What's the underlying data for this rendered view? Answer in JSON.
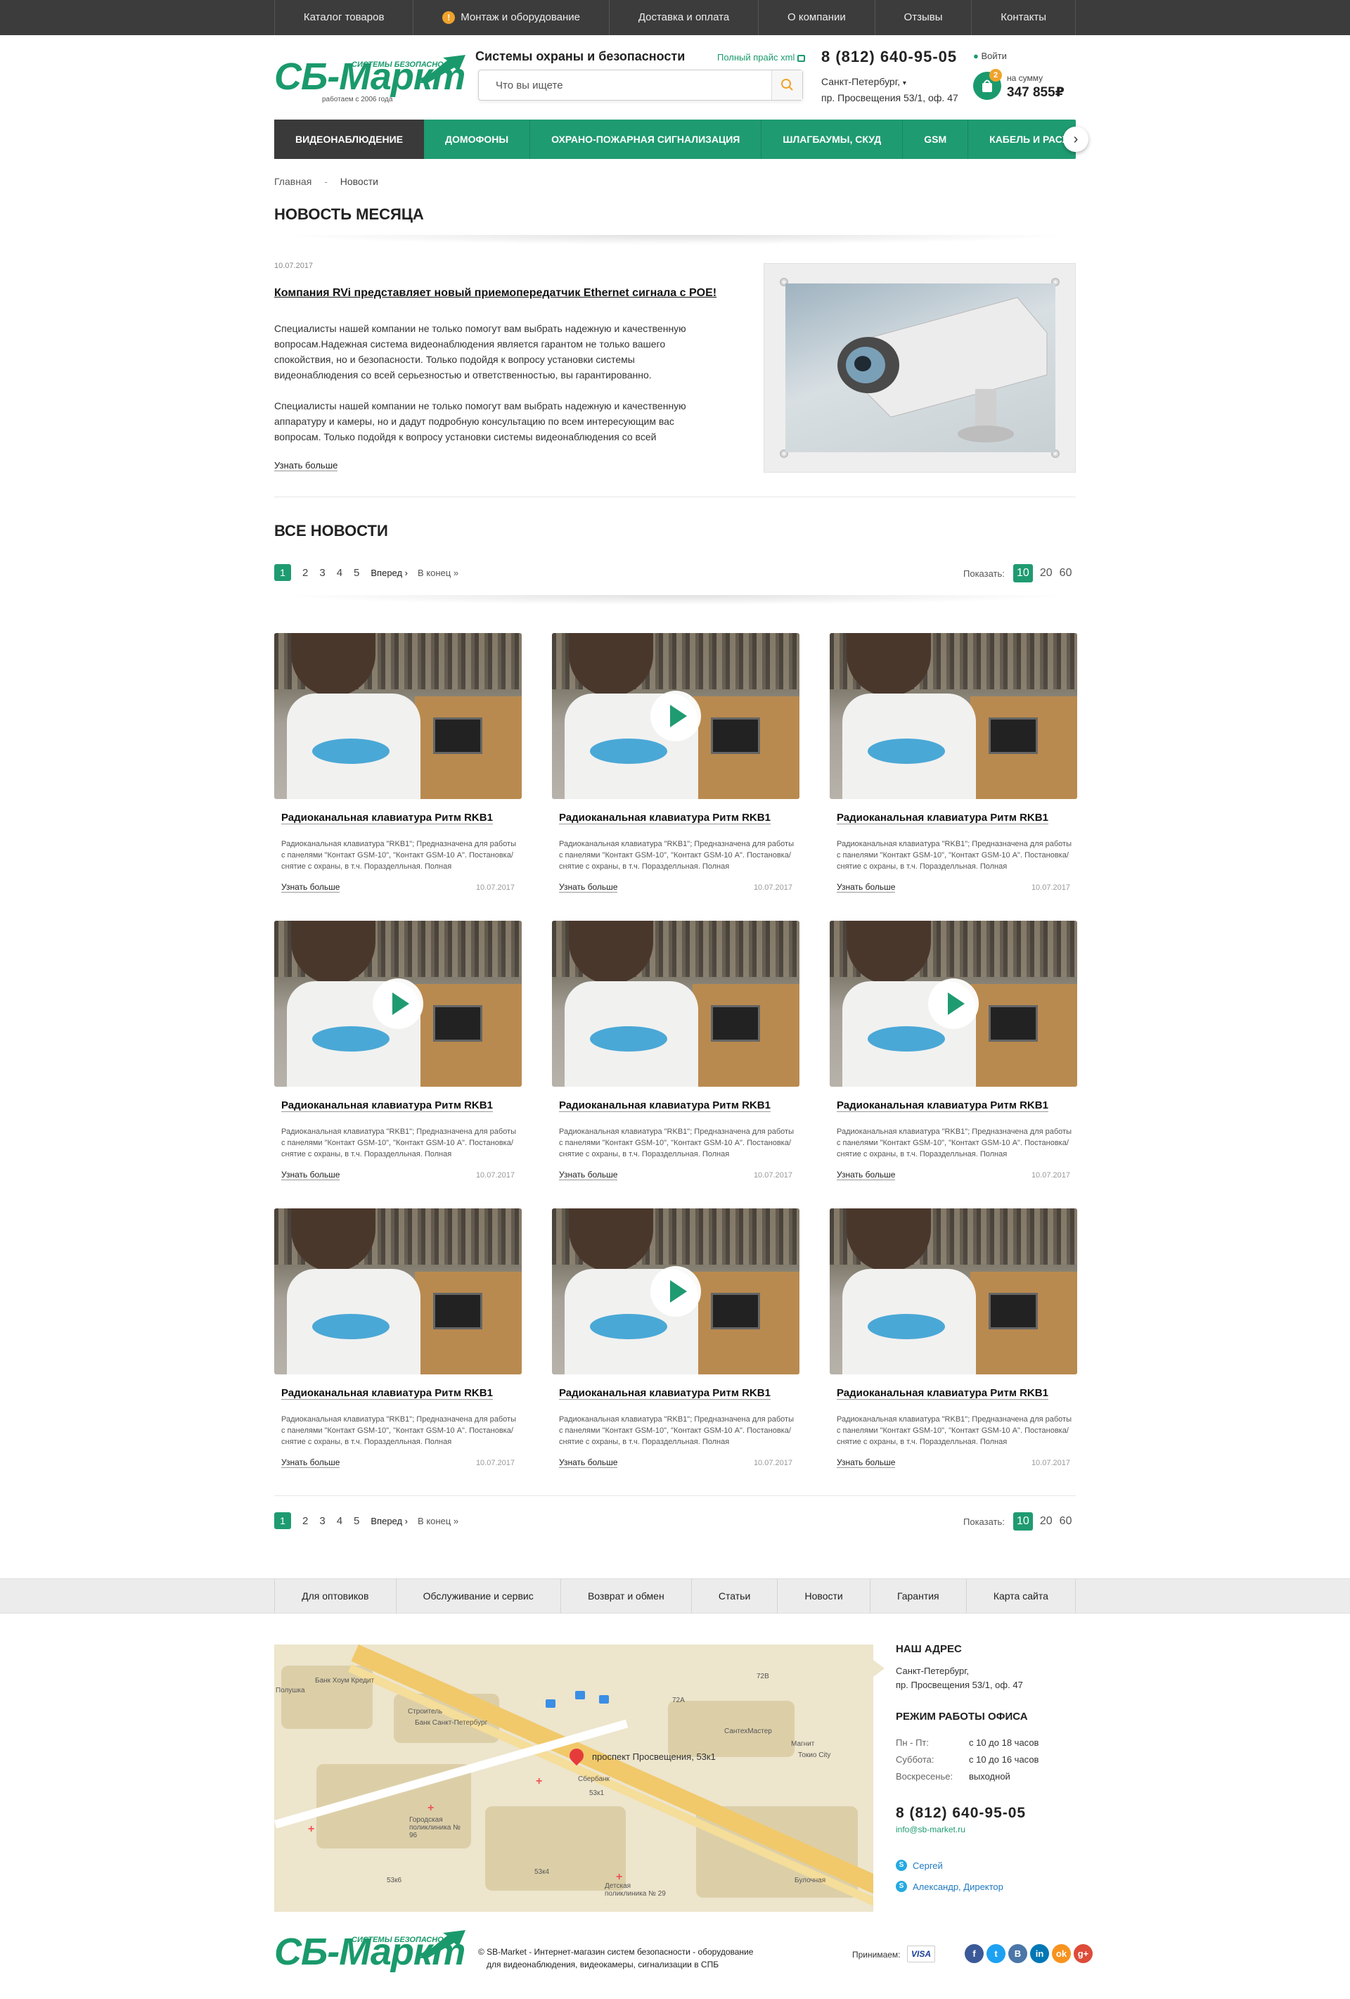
{
  "topbar": {
    "items": [
      "Каталог товаров",
      "Монтаж и оборудование",
      "Доставка и оплата",
      "О компании",
      "Отзывы",
      "Контакты"
    ],
    "warn_icon": "!"
  },
  "header": {
    "logo_name": "СБ-Маркт",
    "logo_sub": "СИСТЕМЫ БЕЗОПАСНОСТИ",
    "logo_tag": "работаем с 2006 года",
    "tagline": "Системы охраны и безопасности",
    "search_placeholder": "Что вы ищете",
    "price_link": "Полный прайс xml",
    "phone": "8 (812) 640-95-05",
    "address_line1": "Санкт-Петербург,",
    "address_line2": "пр. Просвещения 53/1, оф. 47",
    "login": "Войти",
    "cart_count": "2",
    "cart_label": "на сумму",
    "cart_sum": "347 855₽"
  },
  "nav": {
    "items": [
      "ВИДЕОНАБЛЮДЕНИЕ",
      "ДОМОФОНЫ",
      "ОХРАНО-ПОЖАРНАЯ СИГНАЛИЗАЦИЯ",
      "ШЛАГБАУМЫ, СКУД",
      "GSM",
      "КАБЕЛЬ И РАСХОДНИКИ"
    ],
    "active_index": 0,
    "arrow": "›"
  },
  "breadcrumb": {
    "home": "Главная",
    "sep": "-",
    "current": "Новости"
  },
  "featured": {
    "section_title": "НОВОСТЬ МЕСЯЦА",
    "date": "10.07.2017",
    "title": "Компания RVi представляет новый приемопередатчик Ethernet сигнала с POE!",
    "p1": "Специалисты нашей компании не только помогут вам выбрать надежную и качественную вопросам.Надежная система видеонаблюдения является гарантом не только вашего спокойствия, но и безопасности. Только подойдя к вопросу установки системы видеонаблюдения со всей серьезностью и ответственностью, вы гарантированно.",
    "p2": "Специалисты нашей компании не только помогут вам выбрать надежную и качественную аппаратуру и камеры, но и дадут подробную консультацию по всем интересующим вас вопросам. Только подойдя к вопросу установки системы видеонаблюдения со всей",
    "more": "Узнать больше"
  },
  "all_news": {
    "title": "ВСЕ НОВОСТИ",
    "pages": [
      "1",
      "2",
      "3",
      "4",
      "5"
    ],
    "current_page": "1",
    "forward": "Вперед ›",
    "to_end": "В конец »",
    "show_label": "Показать:",
    "show_options": [
      "10",
      "20",
      "60"
    ],
    "show_active": "10"
  },
  "cards": [
    {
      "title": "Радиоканальная клавиатура Ритм RKB1",
      "desc": "Радиоканальная клавиатура \"RKB1\"; Предназначена для работы с панелями \"Контакт GSM-10\", \"Контакт GSM-10 А\". Постановка/снятие с охраны, в т.ч. Поразделльная. Полная",
      "more": "Узнать больше",
      "date": "10.07.2017",
      "video": false
    },
    {
      "title": "Радиоканальная клавиатура Ритм RKB1",
      "desc": "Радиоканальная клавиатура \"RKB1\"; Предназначена для работы с панелями \"Контакт GSM-10\", \"Контакт GSM-10 А\". Постановка/снятие с охраны, в т.ч. Поразделльная. Полная",
      "more": "Узнать больше",
      "date": "10.07.2017",
      "video": true
    },
    {
      "title": "Радиоканальная клавиатура Ритм RKB1",
      "desc": "Радиоканальная клавиатура \"RKB1\"; Предназначена для работы с панелями \"Контакт GSM-10\", \"Контакт GSM-10 А\". Постановка/снятие с охраны, в т.ч. Поразделльная. Полная",
      "more": "Узнать больше",
      "date": "10.07.2017",
      "video": false
    },
    {
      "title": "Радиоканальная клавиатура Ритм RKB1",
      "desc": "Радиоканальная клавиатура \"RKB1\"; Предназначена для работы с панелями \"Контакт GSM-10\", \"Контакт GSM-10 А\". Постановка/снятие с охраны, в т.ч. Поразделльная. Полная",
      "more": "Узнать больше",
      "date": "10.07.2017",
      "video": true
    },
    {
      "title": "Радиоканальная клавиатура Ритм RKB1",
      "desc": "Радиоканальная клавиатура \"RKB1\"; Предназначена для работы с панелями \"Контакт GSM-10\", \"Контакт GSM-10 А\". Постановка/снятие с охраны, в т.ч. Поразделльная. Полная",
      "more": "Узнать больше",
      "date": "10.07.2017",
      "video": false
    },
    {
      "title": "Радиоканальная клавиатура Ритм RKB1",
      "desc": "Радиоканальная клавиатура \"RKB1\"; Предназначена для работы с панелями \"Контакт GSM-10\", \"Контакт GSM-10 А\". Постановка/снятие с охраны, в т.ч. Поразделльная. Полная",
      "more": "Узнать больше",
      "date": "10.07.2017",
      "video": true
    },
    {
      "title": "Радиоканальная клавиатура Ритм RKB1",
      "desc": "Радиоканальная клавиатура \"RKB1\"; Предназначена для работы с панелями \"Контакт GSM-10\", \"Контакт GSM-10 А\". Постановка/снятие с охраны, в т.ч. Поразделльная. Полная",
      "more": "Узнать больше",
      "date": "10.07.2017",
      "video": false
    },
    {
      "title": "Радиоканальная клавиатура Ритм RKB1",
      "desc": "Радиоканальная клавиатура \"RKB1\"; Предназначена для работы с панелями \"Контакт GSM-10\", \"Контакт GSM-10 А\". Постановка/снятие с охраны, в т.ч. Поразделльная. Полная",
      "more": "Узнать больше",
      "date": "10.07.2017",
      "video": true
    },
    {
      "title": "Радиоканальная клавиатура Ритм RKB1",
      "desc": "Радиоканальная клавиатура \"RKB1\"; Предназначена для работы с панелями \"Контакт GSM-10\", \"Контакт GSM-10 А\". Постановка/снятие с охраны, в т.ч. Поразделльная. Полная",
      "more": "Узнать больше",
      "date": "10.07.2017",
      "video": false
    }
  ],
  "footer_links": [
    "Для оптовиков",
    "Обслуживание и сервис",
    "Возврат и обмен",
    "Статьи",
    "Новости",
    "Гарантия",
    "Карта сайта"
  ],
  "map": {
    "pin_label": "проспект Просвещения, 53к1",
    "labels": [
      "Банк Хоум Кредит",
      "Полушка",
      "Строитель",
      "Банк Санкт-Петербург",
      "СантехМастер",
      "Магнит",
      "Токио City",
      "Сбербанк",
      "Городская поликлиника № 96",
      "Детская поликлиника № 29",
      "Булочная",
      "53к1",
      "53к4",
      "53к6",
      "72В",
      "72А"
    ]
  },
  "contacts": {
    "addr_title": "НАШ АДРЕС",
    "addr1": "Санкт-Петербург,",
    "addr2": "пр. Просвещения 53/1, оф. 47",
    "hours_title": "РЕЖИМ РАБОТЫ ОФИСА",
    "hours": [
      {
        "day": "Пн - Пт:",
        "time": "с 10 до 18 часов"
      },
      {
        "day": "Суббота:",
        "time": "с 10 до 16 часов"
      },
      {
        "day": "Воскресенье:",
        "time": "выходной"
      }
    ],
    "phone": "8 (812) 640-95-05",
    "email": "info@sb-market.ru",
    "skype": [
      "Сергей",
      "Александр, Директор"
    ]
  },
  "footer": {
    "copy1": "© SB-Market - Интернет-магазин систем безопасности - оборудование",
    "copy2": "для видеонаблюдения, видеокамеры, сигнализации в СПБ",
    "accept": "Принимаем:",
    "visa": "VISA",
    "social": [
      "f",
      "t",
      "В",
      "in",
      "ok",
      "g+"
    ],
    "social_colors": [
      "#3b5998",
      "#1da1f2",
      "#4a76a8",
      "#0077b5",
      "#f7931e",
      "#dd4b39"
    ]
  }
}
